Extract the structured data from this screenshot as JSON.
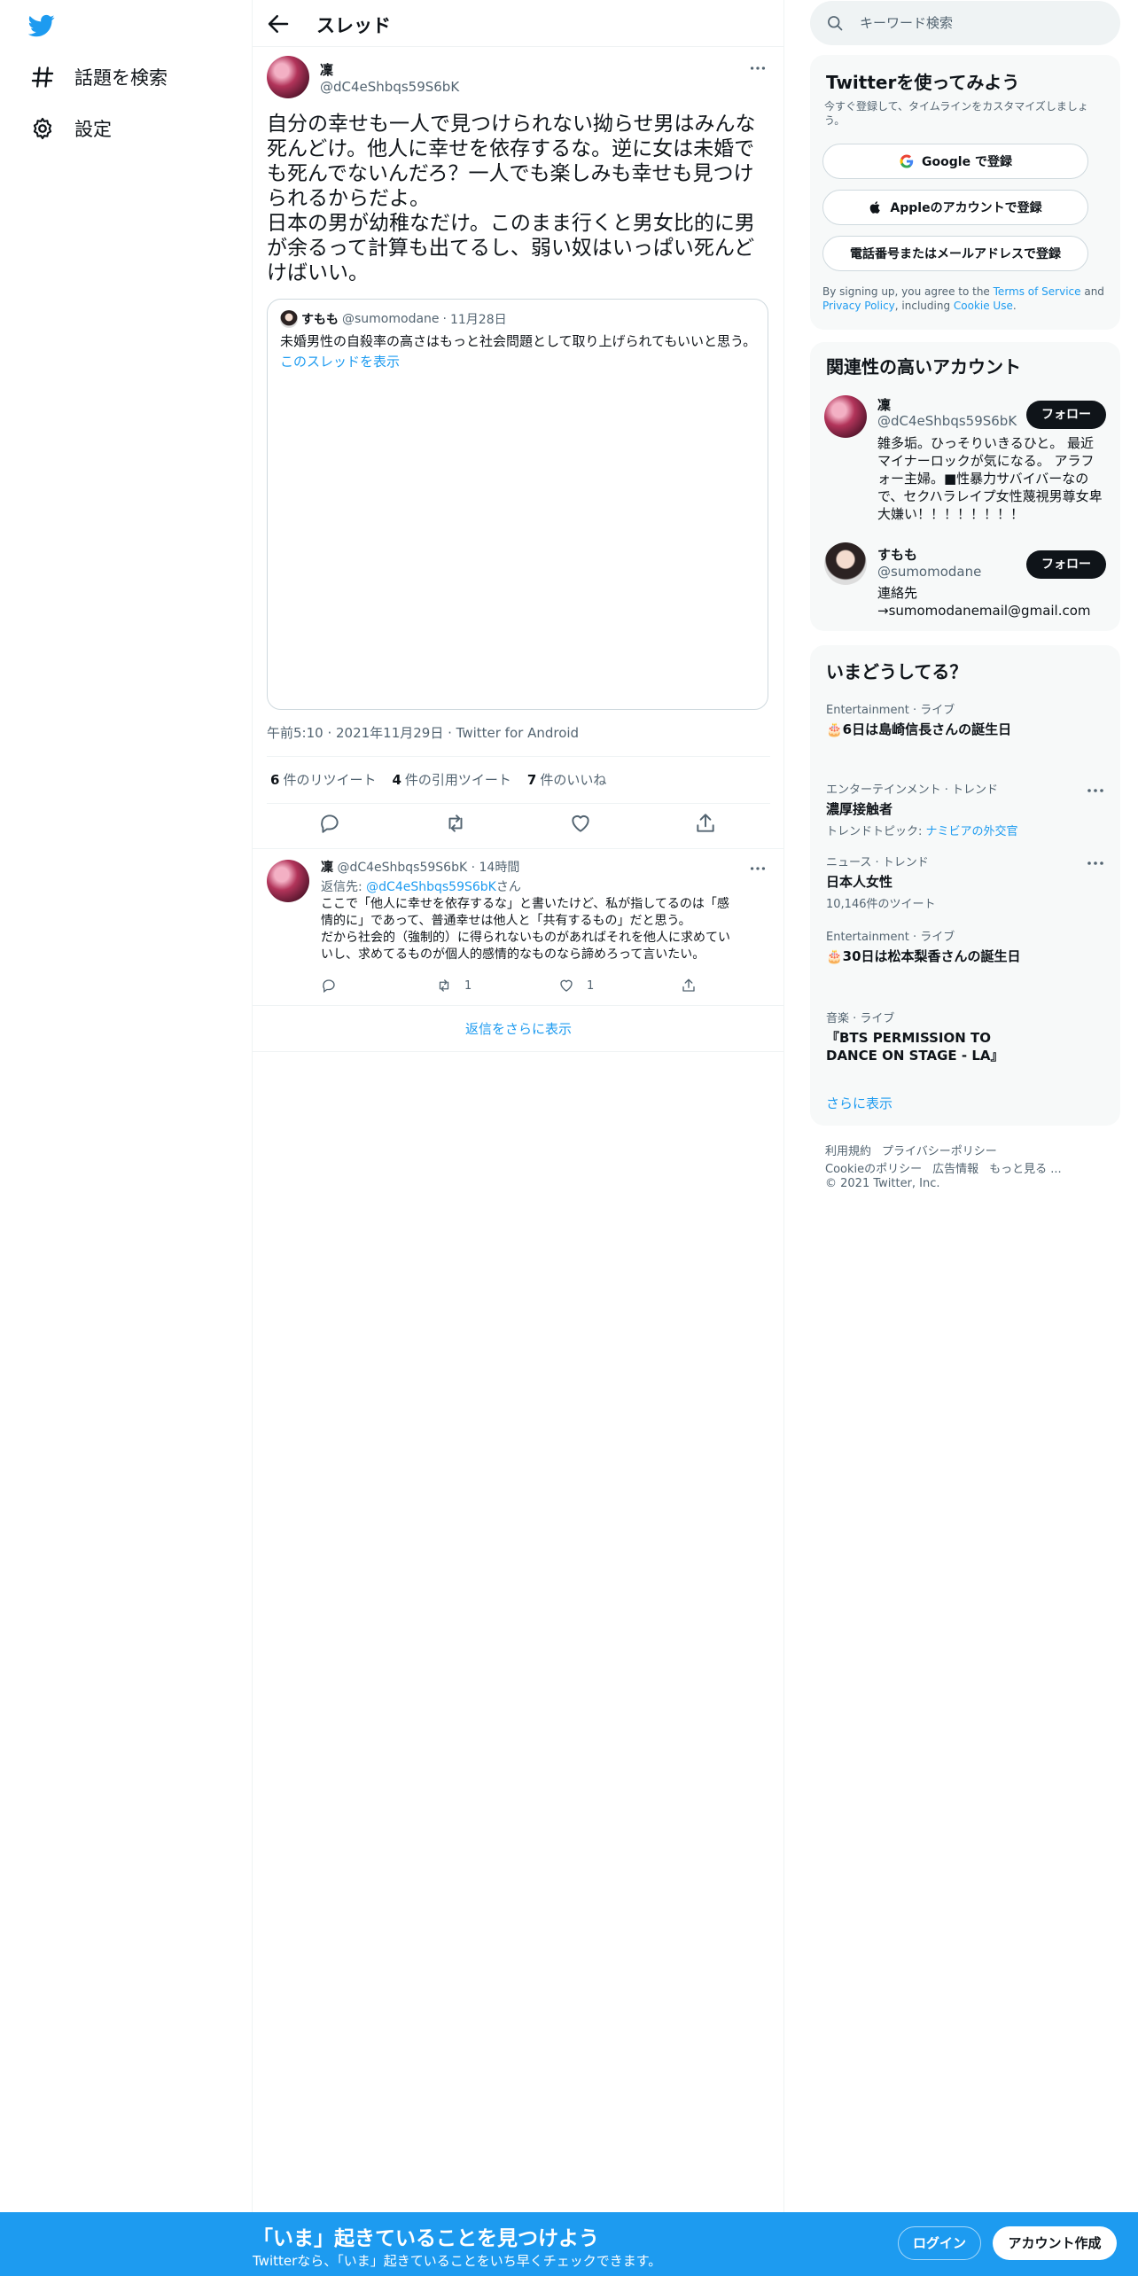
{
  "nav": {
    "items": [
      {
        "label": "話題を検索",
        "icon": "hashtag-icon"
      },
      {
        "label": "設定",
        "icon": "gear-icon"
      }
    ]
  },
  "header": {
    "title": "スレッド"
  },
  "tweet": {
    "author_name": "凜",
    "author_handle": "@dC4eShbqs59S6bK",
    "text": "自分の幸せも一人で見つけられない拗らせ男はみんな死んどけ。他人に幸せを依存するな。逆に女は未婚でも死んでないんだろ？一人でも楽しみも幸せも見つけられるからだよ。\n日本の男が幼稚なだけ。このまま行くと男女比的に男が余るって計算も出てるし、弱い奴はいっぱい死んどけばいい。",
    "quote": {
      "author_name": "すもも",
      "author_handle": "@sumomodane",
      "sep": "·",
      "date": "11月28日",
      "text": "未婚男性の自殺率の高さはもっと社会問題として取り上げられてもいいと思う。",
      "thread_link": "このスレッドを表示"
    },
    "meta": "午前5:10 · 2021年11月29日 · Twitter for Android",
    "stats": [
      {
        "count": "6",
        "label": "件のリツイート"
      },
      {
        "count": "4",
        "label": "件の引用ツイート"
      },
      {
        "count": "7",
        "label": "件のいいね"
      }
    ]
  },
  "reply": {
    "author_name": "凜",
    "author_handle": "@dC4eShbqs59S6bK",
    "sep": "·",
    "time": "14時間",
    "reply_to_prefix": "返信先: ",
    "reply_to_handle": "@dC4eShbqs59S6bK",
    "reply_to_suffix": "さん",
    "lines": [
      "ここで「他人に幸せを依存するな」と書いたけど、私が指してるのは「感",
      "情的に」であって、普通幸せは他人と「共有するもの」だと思う。",
      "だから社会的（強制的）に得られないものがあればそれを他人に求めてい",
      "いし、求めてるものが個人的感情的なものなら諦めろって言いたい。"
    ],
    "retweets": "1",
    "likes": "1"
  },
  "show_more_replies": "返信をさらに表示",
  "search": {
    "placeholder": "キーワード検索"
  },
  "signup_card": {
    "title": "Twitterを使ってみよう",
    "subtitle": "今すぐ登録して、タイムラインをカスタマイズしましょう。",
    "google_btn": "Google で登録",
    "apple_btn": "Appleのアカウントで登録",
    "phone_btn": "電話番号またはメールアドレスで登録",
    "terms_pre": "By signing up, you agree to the ",
    "terms_link": "Terms of Service",
    "terms_and": " and ",
    "privacy_link": "Privacy Policy",
    "terms_mid": ", including ",
    "cookie_link": "Cookie Use",
    "terms_end": "."
  },
  "related": {
    "title": "関連性の高いアカウント",
    "accounts": [
      {
        "name": "凜",
        "handle": "@dC4eShbqs59S6bK",
        "follow": "フォロー",
        "bio": [
          "雑多垢。ひっそりいきるひと。 最近",
          "マイナーロックが気になる。 アラフ",
          "ォー主婦。■性暴力サバイバーなの",
          "で、セクハラレイプ女性蔑視男尊女卑",
          "大嫌い！！！！！！！！"
        ]
      },
      {
        "name": "すもも",
        "handle": "@sumomodane",
        "follow": "フォロー",
        "bio": [
          "連絡先",
          "→sumomodanemail@gmail.com"
        ]
      }
    ]
  },
  "trends": {
    "title": "いまどうしてる？",
    "items": [
      {
        "context": "Entertainment · ライブ",
        "title": "🎂6日は島崎信長さんの誕生日",
        "sub": ""
      },
      {
        "context": "エンターテインメント · トレンド",
        "title": "濃厚接触者",
        "sub_prefix": "トレンドトピック: ",
        "sub_link": "ナミビアの外交官"
      },
      {
        "context": "ニュース · トレンド",
        "title": "日本人女性",
        "sub": "10,146件のツイート"
      },
      {
        "context": "Entertainment · ライブ",
        "title": "🎂30日は松本梨香さんの誕生日",
        "sub": ""
      },
      {
        "context": "音楽 · ライブ",
        "title": "『BTS PERMISSION TO DANCE ON STAGE - LA』",
        "sub": ""
      }
    ],
    "show_more": "さらに表示"
  },
  "footer": {
    "line1": [
      "利用規約",
      "プライバシーポリシー"
    ],
    "line2": [
      "Cookieのポリシー",
      "広告情報",
      "もっと見る ..."
    ],
    "copyright": "© 2021 Twitter, Inc."
  },
  "banner": {
    "title": "「いま」起きていることを見つけよう",
    "subtitle": "Twitterなら、「いま」起きていることをいち早くチェックできます。",
    "login": "ログイン",
    "signup": "アカウント作成"
  },
  "colors": {
    "accent": "#1d9bf0",
    "text": "#0f1419",
    "muted": "#536471"
  }
}
